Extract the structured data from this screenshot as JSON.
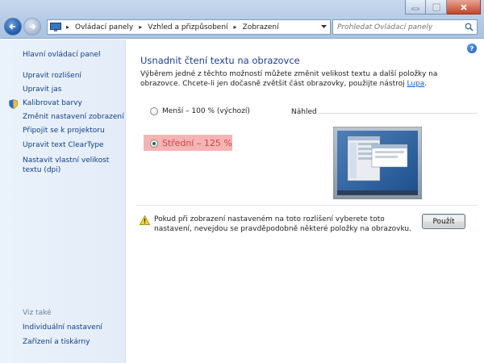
{
  "address": {
    "crumbs": [
      "Ovládací panely",
      "Vzhled a přizpůsobení",
      "Zobrazení"
    ]
  },
  "search": {
    "placeholder": "Prohledat Ovládací panely"
  },
  "sidebar": {
    "home": "Hlavní ovládací panel",
    "items": [
      "Upravit rozlišení",
      "Upravit jas",
      "Kalibrovat barvy",
      "Změnit nastavení zobrazení",
      "Připojit se k projektoru",
      "Upravit text ClearType",
      "Nastavit vlastní velikost textu (dpi)"
    ],
    "see_also": {
      "label": "Viz také",
      "items": [
        "Individuální nastavení",
        "Zařízení a tiskárny"
      ]
    }
  },
  "main": {
    "title": "Usnadnit čtení textu na obrazovce",
    "description": "Výběrem jedné z těchto možností můžete změnit velikost textu a další položky na obrazovce. Chcete-li jen dočasně zvětšit část obrazovky, použijte nástroj ",
    "description_link": "Lupa",
    "description_end": ".",
    "options": [
      {
        "label": "Menší – 100 % (výchozí)",
        "selected": false
      },
      {
        "label": "Střední – 125 %",
        "selected": true
      }
    ],
    "preview_label": "Náhled",
    "warning": "Pokud při zobrazení nastaveném na toto rozlišení vyberete toto nastavení, nevejdou se pravděpodobně některé položky na obrazovku.",
    "apply_label": "Použít",
    "help": "?"
  },
  "colors": {
    "highlight": "#f5b4b4",
    "link": "#0f3f88",
    "title": "#1f3f8f",
    "selected_option": "#d0444a"
  }
}
